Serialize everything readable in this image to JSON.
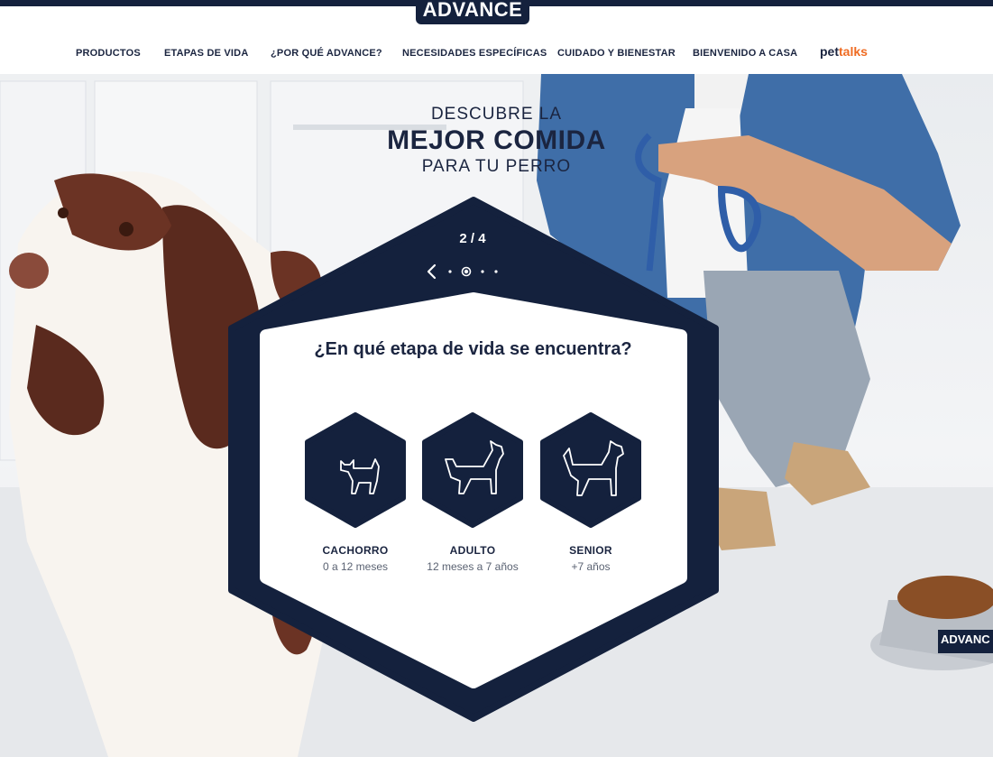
{
  "brand": {
    "logo_text": "ADVANCE"
  },
  "nav": {
    "items": [
      "PRODUCTOS",
      "ETAPAS DE VIDA",
      "¿POR QUÉ ADVANCE?",
      "NECESIDADES ESPECÍFICAS",
      "CUIDADO Y BIENESTAR",
      "BIENVENIDO A CASA"
    ],
    "pettalks": {
      "part1": "pet",
      "part2": "talks"
    }
  },
  "hero": {
    "line1": "DESCUBRE LA",
    "line2": "MEJOR COMIDA",
    "line3": "PARA TU PERRO",
    "bowl_label": "ADVANC"
  },
  "carousel": {
    "counter": "2 / 4",
    "current": 2,
    "total": 4
  },
  "panel": {
    "question": "¿En qué etapa de vida se encuentra?",
    "stages": [
      {
        "name": "CACHORRO",
        "range": "0 a 12 meses",
        "icon": "puppy-icon"
      },
      {
        "name": "ADULTO",
        "range": "12 meses a 7 años",
        "icon": "adult-dog-icon"
      },
      {
        "name": "SENIOR",
        "range": "+7 años",
        "icon": "senior-dog-icon"
      }
    ]
  },
  "colors": {
    "navy": "#14213d",
    "text": "#1b2540",
    "accent_orange": "#ef6b22",
    "denim": "#3f6ea8"
  }
}
